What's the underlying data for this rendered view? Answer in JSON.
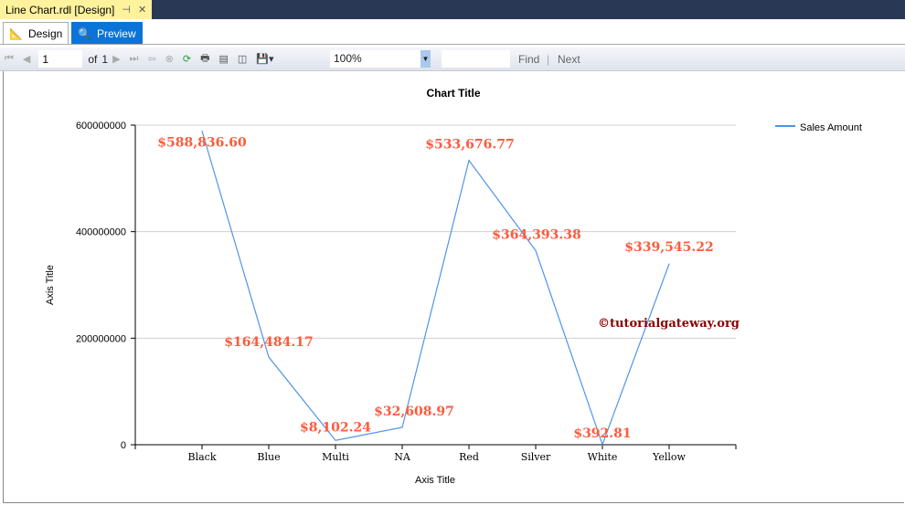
{
  "window": {
    "doc_tab": "Line Chart.rdl [Design]",
    "pin_icon": "pin-icon",
    "close_icon": "close-icon"
  },
  "tabs": [
    {
      "label": "Design",
      "icon": "design-icon"
    },
    {
      "label": "Preview",
      "icon": "preview-icon"
    }
  ],
  "toolbar": {
    "page": "1",
    "of_label": "of",
    "total_pages": "1",
    "zoom": "100%",
    "find_label": "Find",
    "next_label": "Next"
  },
  "watermark": "©tutorialgateway.org",
  "chart_data": {
    "type": "line",
    "title": "Chart Title",
    "xlabel": "Axis Title",
    "ylabel": "Axis Title",
    "categories": [
      "Black",
      "Blue",
      "Multi",
      "NA",
      "Red",
      "Silver",
      "White",
      "Yellow"
    ],
    "series": [
      {
        "name": "Sales Amount",
        "color": "#4f94e8",
        "values": [
          588836600,
          164484170,
          8102240,
          32608970,
          533676770,
          364393380,
          392810,
          339545220
        ],
        "labels": [
          "$588,836.60",
          "$164,484.17",
          "$8,102.24",
          "$32,608.97",
          "$533,676.77",
          "$364,393.38",
          "$392.81",
          "$339,545.22"
        ]
      }
    ],
    "ylim": [
      0,
      600000000
    ],
    "yticks": [
      "0",
      "200000000",
      "400000000",
      "600000000"
    ],
    "grid": true,
    "legend": "top-right"
  }
}
